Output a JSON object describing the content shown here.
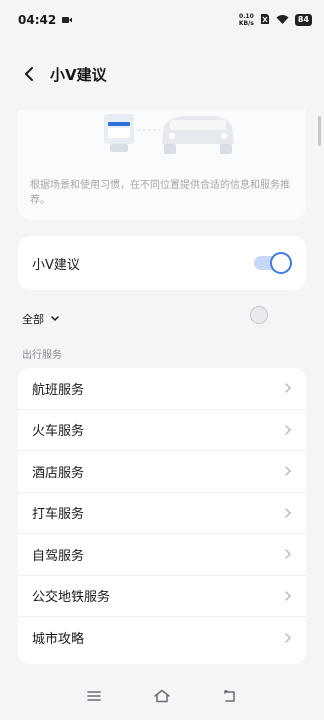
{
  "status": {
    "time": "04:42",
    "net_speed_value": "0.10",
    "net_speed_unit": "KB/s",
    "battery": "84"
  },
  "header": {
    "title": "小V建议"
  },
  "intro": {
    "text": "根据场景和使用习惯，在不同位置提供合适的信息和服务推荐。"
  },
  "toggle_card": {
    "label": "小V建议",
    "enabled": true
  },
  "filter": {
    "label": "全部"
  },
  "section": {
    "title": "出行服务"
  },
  "services": [
    {
      "label": "航班服务"
    },
    {
      "label": "火车服务"
    },
    {
      "label": "酒店服务"
    },
    {
      "label": "打车服务"
    },
    {
      "label": "自驾服务"
    },
    {
      "label": "公交地铁服务"
    },
    {
      "label": "城市攻略"
    }
  ],
  "colors": {
    "accent": "#3b7be8",
    "background": "#f4f5f7",
    "card": "#ffffff",
    "muted_text": "#a3a6ab"
  },
  "icons": {
    "back": "back-arrow-icon",
    "chevron": "chevron-right-icon",
    "filter_chevron": "chevron-down-icon",
    "nav_menu": "menu-icon",
    "nav_home": "home-icon",
    "nav_back": "back-nav-icon"
  }
}
